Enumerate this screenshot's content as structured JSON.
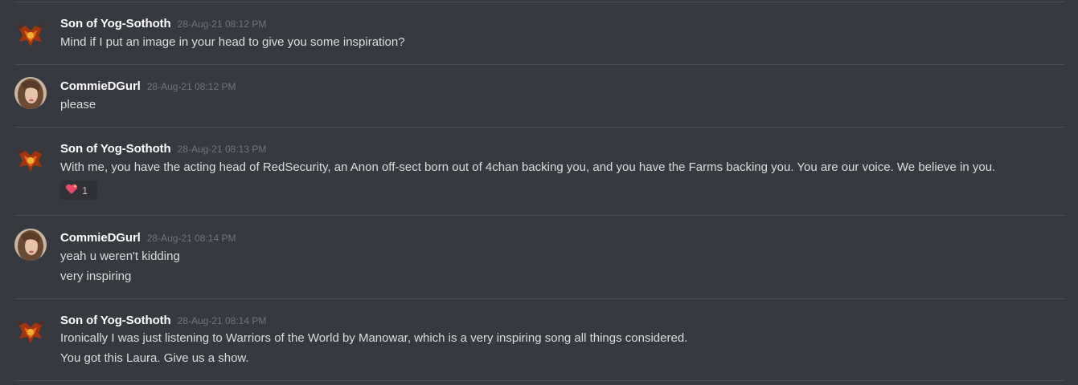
{
  "messages": [
    {
      "author": "Son of Yog-Sothoth",
      "avatar": "dragon-emblem-avatar",
      "timestamp": "28-Aug-21 08:12 PM",
      "lines": [
        "Mind if I put an image in your head to give you some inspiration?"
      ]
    },
    {
      "author": "CommieDGurl",
      "avatar": "woman-portrait-avatar",
      "timestamp": "28-Aug-21 08:12 PM",
      "lines": [
        "please"
      ]
    },
    {
      "author": "Son of Yog-Sothoth",
      "avatar": "dragon-emblem-avatar",
      "timestamp": "28-Aug-21 08:13 PM",
      "lines": [
        "With me, you have the acting head of RedSecurity, an Anon off-sect born out of 4chan backing you, and you have the Farms backing you. You are our voice. We believe in you."
      ],
      "reaction": {
        "emoji": "sparkling-heart-icon",
        "count": "1"
      }
    },
    {
      "author": "CommieDGurl",
      "avatar": "woman-portrait-avatar",
      "timestamp": "28-Aug-21 08:14 PM",
      "lines": [
        "yeah u weren't kidding",
        "very inspiring"
      ]
    },
    {
      "author": "Son of Yog-Sothoth",
      "avatar": "dragon-emblem-avatar",
      "timestamp": "28-Aug-21 08:14 PM",
      "lines": [
        "Ironically I was just listening to Warriors of the World by Manowar, which is a very inspiring song all things considered.",
        "You got this Laura. Give us a show."
      ]
    }
  ],
  "colors": {
    "background": "#36393f",
    "username": "#ffffff",
    "timestamp": "#72767d",
    "text": "#dcddde",
    "divider": "#4a4d53",
    "reaction_bg": "#2f3136",
    "heart": "#e94b6e"
  }
}
